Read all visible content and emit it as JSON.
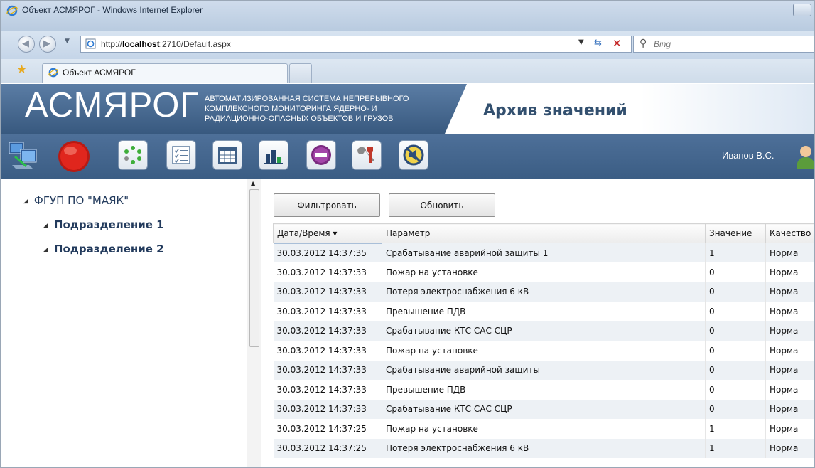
{
  "browser": {
    "window_title": "Объект АСМЯРОГ - Windows Internet Explorer",
    "url_prefix": "http://",
    "url_host": "localhost",
    "url_rest": ":2710/Default.aspx",
    "search_placeholder": "Bing",
    "tab_title": "Объект АСМЯРОГ"
  },
  "app": {
    "logo": "АСМЯРОГ",
    "subtitle_lines": [
      "АВТОМАТИЗИРОВАННАЯ СИСТЕМА НЕПРЕРЫВНОГО",
      "КОМПЛЕКСНОГО МОНИТОРИНГА ЯДЕРНО- И",
      "РАДИАЦИОННО-ОПАСНЫХ ОБЪЕКТОВ И ГРУЗОВ"
    ],
    "page_title": "Архив значений",
    "user_name": "Иванов В.С.",
    "toolbar_icons": [
      "network-icon",
      "alarm-icon",
      "status-dots-icon",
      "checklist-icon",
      "table-icon",
      "bar-chart-icon",
      "stop-icon",
      "tools-icon",
      "no-sound-icon"
    ]
  },
  "tree": {
    "root": "ФГУП ПО \"МАЯК\"",
    "children": [
      "Подразделение 1",
      "Подразделение 2"
    ]
  },
  "actions": {
    "filter_label": "Фильтровать",
    "refresh_label": "Обновить"
  },
  "grid": {
    "columns": [
      "Дата/Время ▾",
      "Параметр",
      "Значение",
      "Качество"
    ],
    "rows": [
      [
        "30.03.2012 14:37:35",
        "Срабатывание аварийной защиты 1",
        "1",
        "Норма"
      ],
      [
        "30.03.2012 14:37:33",
        "Пожар на установке",
        "0",
        "Норма"
      ],
      [
        "30.03.2012 14:37:33",
        "Потеря электроснабжения 6 кВ",
        "0",
        "Норма"
      ],
      [
        "30.03.2012 14:37:33",
        "Превышение ПДВ",
        "0",
        "Норма"
      ],
      [
        "30.03.2012 14:37:33",
        "Срабатывание КТС САС СЦР",
        "0",
        "Норма"
      ],
      [
        "30.03.2012 14:37:33",
        "Пожар на установке",
        "0",
        "Норма"
      ],
      [
        "30.03.2012 14:37:33",
        "Срабатывание аварийной защиты",
        "0",
        "Норма"
      ],
      [
        "30.03.2012 14:37:33",
        "Превышение ПДВ",
        "0",
        "Норма"
      ],
      [
        "30.03.2012 14:37:33",
        "Срабатывание КТС САС СЦР",
        "0",
        "Норма"
      ],
      [
        "30.03.2012 14:37:25",
        "Пожар на установке",
        "1",
        "Норма"
      ],
      [
        "30.03.2012 14:37:25",
        "Потеря электроснабжения 6 кВ",
        "1",
        "Норма"
      ]
    ]
  },
  "colors": {
    "header_dark": "#38597f",
    "toolbar": "#4e7099",
    "row_alt": "#edf1f5",
    "title_text": "#33506f"
  }
}
